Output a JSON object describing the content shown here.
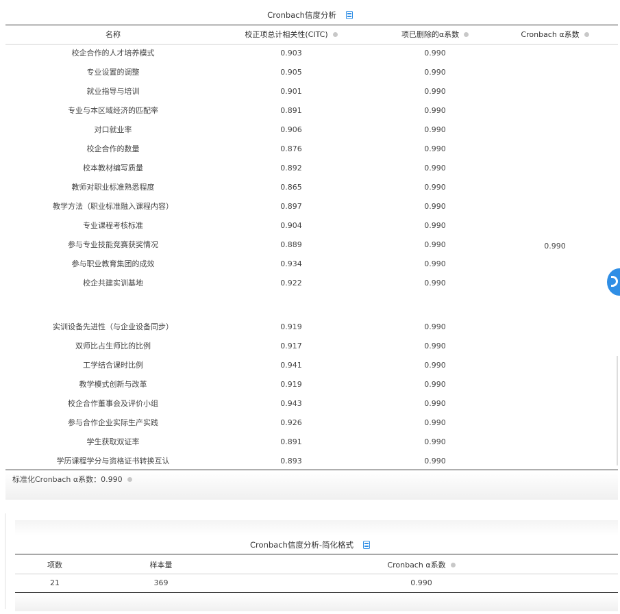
{
  "table1": {
    "title": "Cronbach信度分析",
    "headers": [
      "名称",
      "校正项总计相关性(CITC)",
      "项已删除的α系数",
      "Cronbach α系数"
    ],
    "rows_top": [
      [
        "校企合作的人才培养模式",
        "0.903",
        "0.990"
      ],
      [
        "专业设置的调整",
        "0.905",
        "0.990"
      ],
      [
        "就业指导与培训",
        "0.901",
        "0.990"
      ],
      [
        "专业与本区域经济的匹配率",
        "0.891",
        "0.990"
      ],
      [
        "对口就业率",
        "0.906",
        "0.990"
      ],
      [
        "校企合作的数量",
        "0.876",
        "0.990"
      ],
      [
        "校本教材编写质量",
        "0.892",
        "0.990"
      ],
      [
        "教师对职业标准熟悉程度",
        "0.865",
        "0.990"
      ],
      [
        "教学方法（职业标准融入课程内容）",
        "0.897",
        "0.990"
      ],
      [
        "专业课程考核标准",
        "0.904",
        "0.990"
      ],
      [
        "参与专业技能竞赛获奖情况",
        "0.889",
        "0.990"
      ],
      [
        "参与职业教育集团的成效",
        "0.934",
        "0.990"
      ],
      [
        "校企共建实训基地",
        "0.922",
        "0.990"
      ]
    ],
    "rows_bottom": [
      [
        "实训设备先进性（与企业设备同步）",
        "0.919",
        "0.990"
      ],
      [
        "双师比占生师比的比例",
        "0.917",
        "0.990"
      ],
      [
        "工学结合课时比例",
        "0.941",
        "0.990"
      ],
      [
        "教学模式创新与改革",
        "0.919",
        "0.990"
      ],
      [
        "校企合作董事会及评价小组",
        "0.943",
        "0.990"
      ],
      [
        "参与合作企业实际生产实践",
        "0.926",
        "0.990"
      ],
      [
        "学生获取双证率",
        "0.891",
        "0.990"
      ],
      [
        "学历课程学分与资格证书转换互认",
        "0.893",
        "0.990"
      ]
    ],
    "overall_alpha": "0.990",
    "footnote": "标准化Cronbach α系数：0.990"
  },
  "table2": {
    "title": "Cronbach信度分析-简化格式",
    "headers": [
      "项数",
      "样本量",
      "Cronbach α系数"
    ],
    "row": [
      "21",
      "369",
      "0.990"
    ]
  },
  "colors": {
    "accent": "#2f8ee5",
    "rule": "#333333",
    "band": "#f3f3f3"
  }
}
